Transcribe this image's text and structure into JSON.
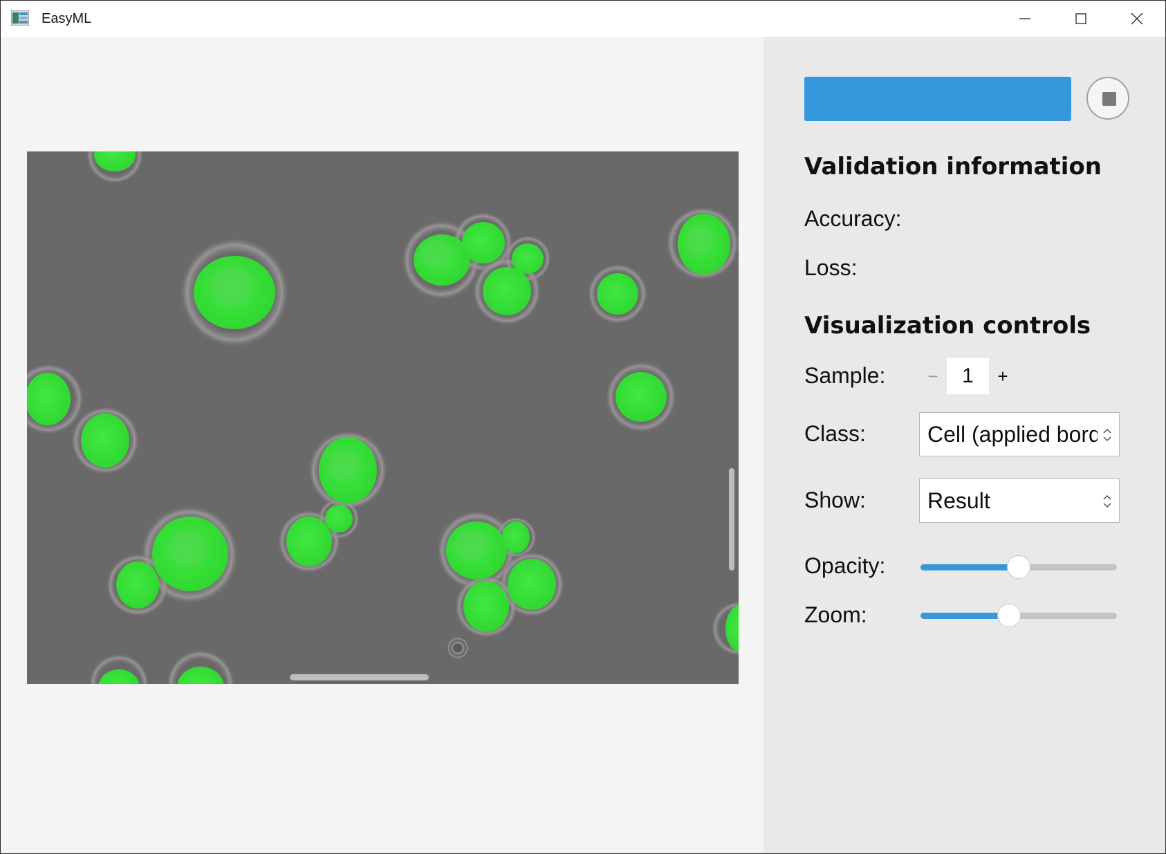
{
  "window": {
    "title": "EasyML",
    "controls": [
      "minimize",
      "maximize",
      "close"
    ]
  },
  "viewer": {
    "content": "segmented-cells-image",
    "overlay_color": "#3dee3d",
    "background_color": "#6a6869"
  },
  "panel": {
    "progress": {
      "fraction": 1.0,
      "color": "#3797dc"
    },
    "validation_heading": "Validation information",
    "accuracy_label": "Accuracy:",
    "loss_label": "Loss:",
    "visualization_heading": "Visualization controls",
    "sample": {
      "label": "Sample:",
      "value": "1",
      "minus": "−",
      "plus": "+"
    },
    "class": {
      "label": "Class:",
      "selected": "Cell (applied border)"
    },
    "show": {
      "label": "Show:",
      "selected": "Result"
    },
    "opacity": {
      "label": "Opacity:",
      "fraction": 0.5
    },
    "zoom": {
      "label": "Zoom:",
      "fraction": 0.45
    }
  },
  "accent_color": "#3797dc"
}
